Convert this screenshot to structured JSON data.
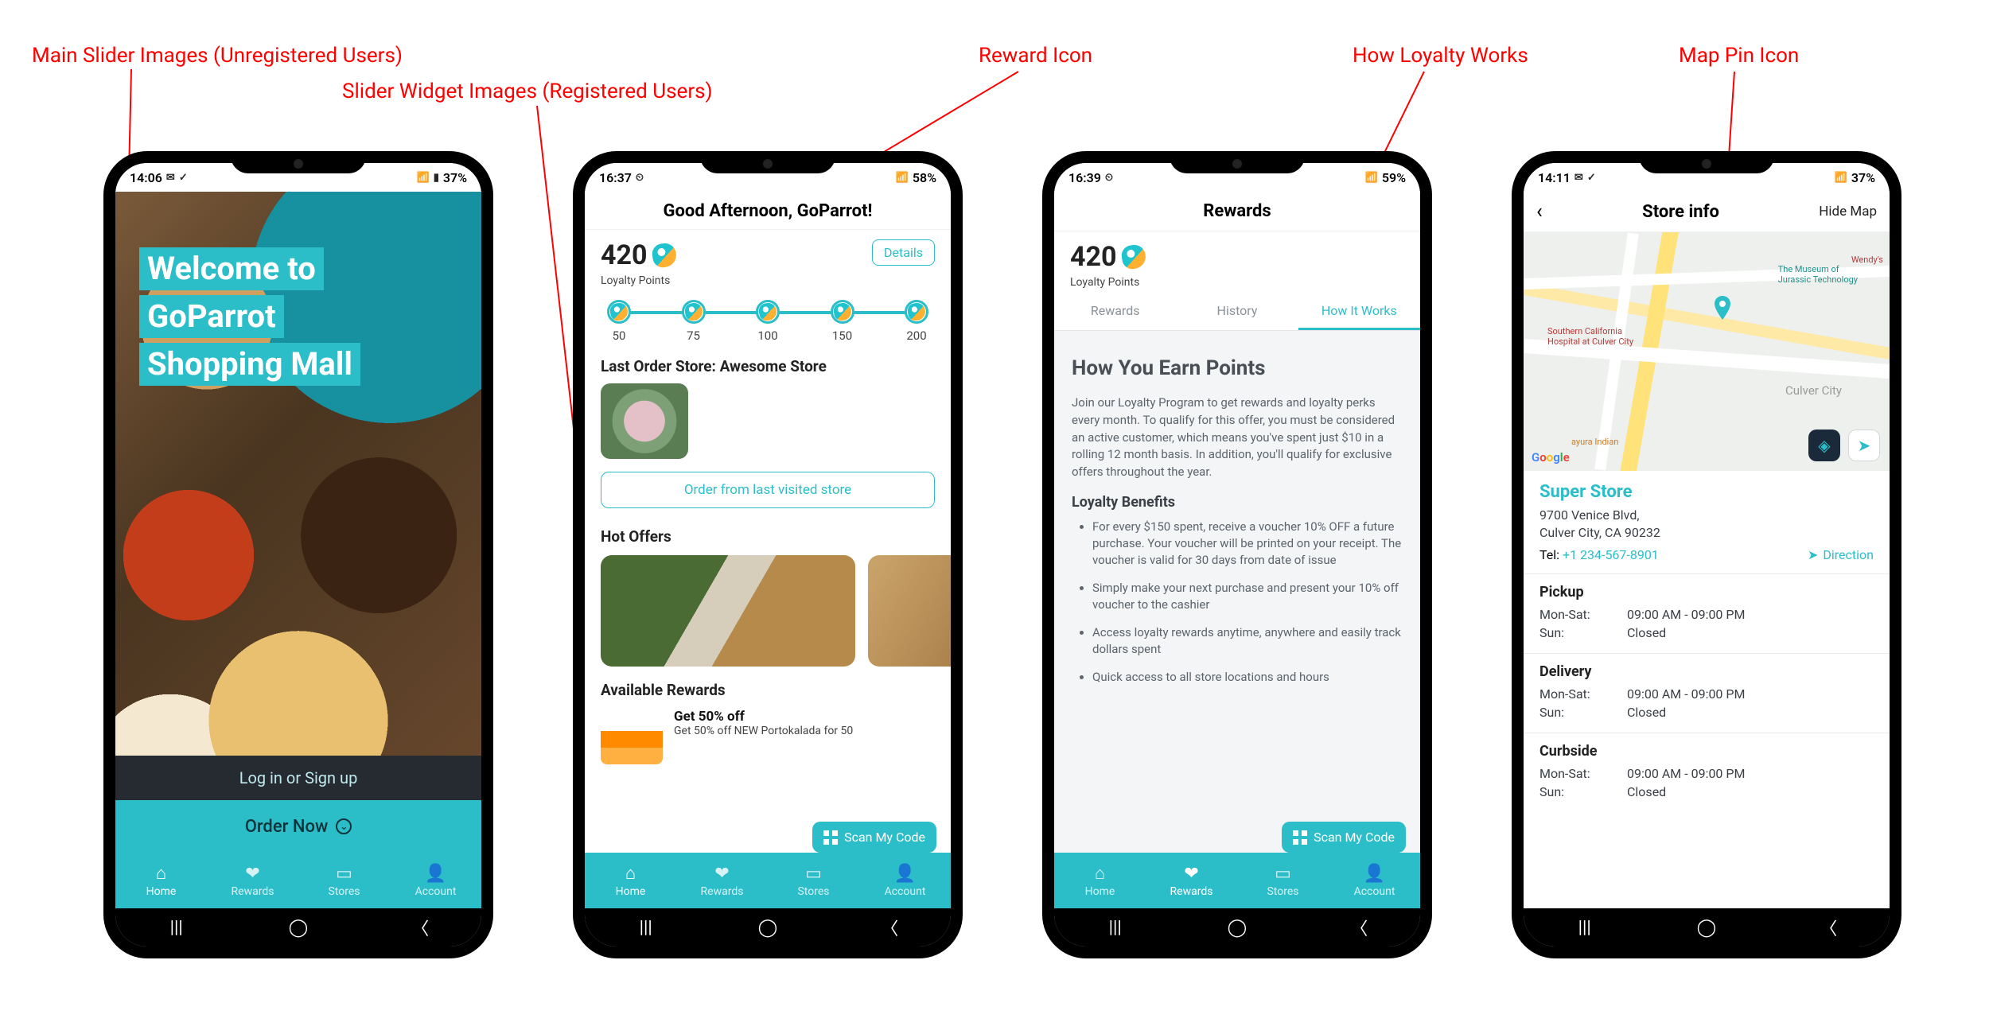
{
  "annotations": {
    "main_slider": "Main Slider Images (Unregistered Users)",
    "slider_widget": "Slider Widget Images (Registered Users)",
    "reward_icon": "Reward Icon",
    "how_loyalty": "How Loyalty Works",
    "map_pin": "Map Pin Icon"
  },
  "tabs": {
    "home": "Home",
    "rewards": "Rewards",
    "stores": "Stores",
    "account": "Account"
  },
  "screen1": {
    "status": {
      "time": "14:06",
      "battery": "37%"
    },
    "hero_line1": "Welcome to",
    "hero_line2": "GoParrot",
    "hero_line3": "Shopping Mall",
    "login": "Log in or Sign up",
    "order": "Order Now"
  },
  "screen2": {
    "status": {
      "time": "16:37",
      "battery": "58%"
    },
    "greeting": "Good Afternoon, GoParrot!",
    "points": "420",
    "points_label": "Loyalty Points",
    "details": "Details",
    "milestones": [
      "50",
      "75",
      "100",
      "150",
      "200"
    ],
    "last_order_heading": "Last Order Store: Awesome Store",
    "order_again": "Order from last visited store",
    "hot_offers": "Hot Offers",
    "available_rewards": "Available Rewards",
    "reward_title": "Get 50% off",
    "reward_sub": "Get 50% off NEW Portokalada for 50",
    "scan": "Scan My Code"
  },
  "screen3": {
    "status": {
      "time": "16:39",
      "battery": "59%"
    },
    "title": "Rewards",
    "points": "420",
    "points_label": "Loyalty Points",
    "tabs": {
      "rewards": "Rewards",
      "history": "History",
      "how": "How It Works"
    },
    "heading": "How You Earn Points",
    "intro_full": "Join our Loyalty Program to get rewards and loyalty perks every month. To qualify for this offer, you must be considered an active customer, which means you've spent just $10 in a  rolling 12 month basis. In addition, you'll qualify for exclusive offers throughout the year.",
    "benefits_head": "Loyalty Benefits",
    "benefits": [
      "For every $150 spent, receive a voucher 10% OFF a future purchase. Your voucher will be printed on your receipt. The voucher is valid for 30 days from date of issue",
      "Simply make your next purchase and present your 10% off voucher to the cashier",
      "Access loyalty rewards anytime, anywhere and easily track dollars spent",
      "Quick access to all store locations and hours"
    ],
    "scan": "Scan My Code"
  },
  "screen4": {
    "status": {
      "time": "14:11",
      "battery": "37%"
    },
    "title": "Store info",
    "hide_map": "Hide Map",
    "pois": {
      "museum": "The Museum of\nJurassic Technology",
      "wendys": "Wendy's",
      "hospital": "Southern California\nHospital at Culver City",
      "city": "Culver City",
      "indian": "ayura Indian",
      "google": "Google"
    },
    "store": {
      "name": "Super Store",
      "addr1": "9700 Venice Blvd,",
      "addr2": "Culver City, CA 90232",
      "tel_label": "Tel:",
      "tel": "+1 234-567-8901",
      "direction": "Direction"
    },
    "hours": [
      {
        "title": "Pickup",
        "rows": [
          [
            "Mon-Sat:",
            "09:00 AM - 09:00 PM"
          ],
          [
            "Sun:",
            "Closed"
          ]
        ]
      },
      {
        "title": "Delivery",
        "rows": [
          [
            "Mon-Sat:",
            "09:00 AM - 09:00 PM"
          ],
          [
            "Sun:",
            "Closed"
          ]
        ]
      },
      {
        "title": "Curbside",
        "rows": [
          [
            "Mon-Sat:",
            "09:00 AM - 09:00 PM"
          ],
          [
            "Sun:",
            "Closed"
          ]
        ]
      }
    ]
  }
}
